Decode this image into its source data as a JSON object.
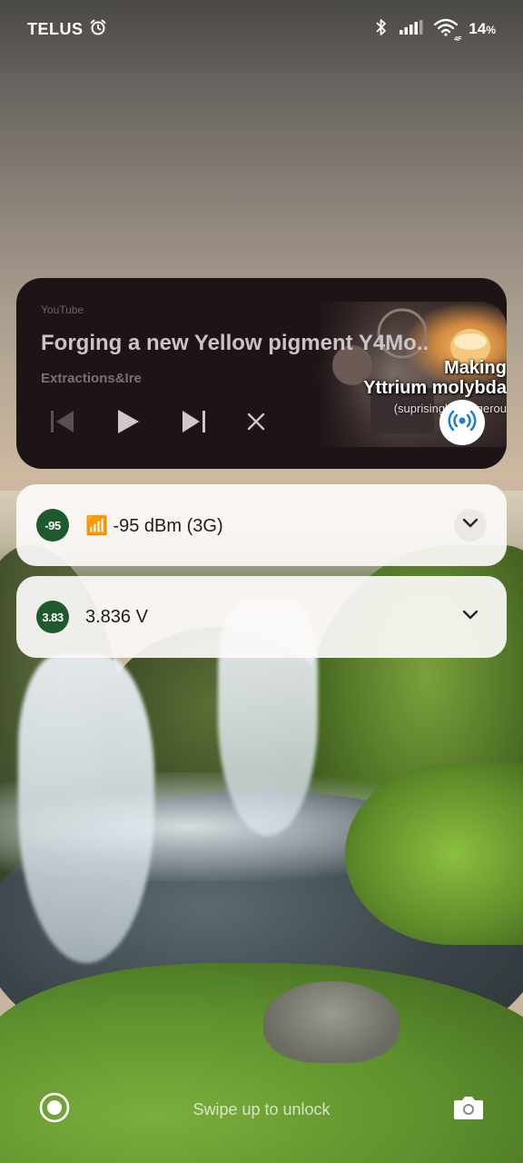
{
  "status_bar": {
    "carrier": "TELUS",
    "alarm_icon": "alarm-icon",
    "bluetooth_icon": "bluetooth-icon",
    "signal_icon": "cell-signal-icon",
    "wifi_icon": "wifi-icon",
    "wifi_badge": "4F",
    "battery_percent": "14",
    "battery_unit": "%"
  },
  "media_player": {
    "source": "YouTube",
    "title": "Forging a new Yellow pigment Y4Mo..",
    "artist": "Extractions&Ire",
    "artwork_text_line1": "Making",
    "artwork_text_line2": "Yttrium molybda",
    "artwork_text_sub": "(suprisingly dangerou",
    "controls": {
      "previous": "skip-previous-icon",
      "play": "play-icon",
      "next": "skip-next-icon",
      "close": "close-icon",
      "cast": "cast-icon"
    }
  },
  "notifications": [
    {
      "icon_text": "-95",
      "signal_emoji": "📶",
      "text": "-95 dBm (3G)"
    },
    {
      "icon_text": "3.83",
      "text": "3.836 V"
    }
  ],
  "bottom_bar": {
    "left_icon": "record-icon",
    "unlock_text": "Swipe up to unlock",
    "right_icon": "camera-icon"
  },
  "colors": {
    "media_bg": "#1e1416",
    "notif_icon_bg": "#1f5a2e",
    "cast_accent": "#1e7fd0"
  }
}
